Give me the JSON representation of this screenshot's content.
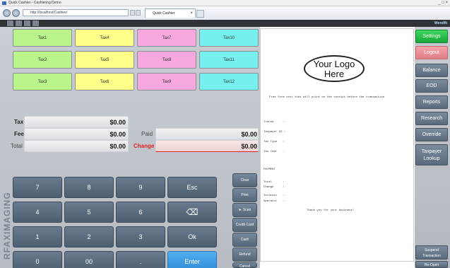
{
  "window": {
    "title": "Quick Cashier - Cashiering Demo",
    "controls": "_ □ ×"
  },
  "browser": {
    "url": "http://localhost/Cashier/",
    "tab_title": "Quick Cashier",
    "tab_close": "×"
  },
  "header": {
    "user_link": "Wendfk"
  },
  "tax_buttons": [
    {
      "label": "Tax1",
      "color": "#b9f58a"
    },
    {
      "label": "Tax4",
      "color": "#fefe88"
    },
    {
      "label": "Tax7",
      "color": "#f7a8de"
    },
    {
      "label": "Tax10",
      "color": "#75f0ef"
    },
    {
      "label": "Tax2",
      "color": "#b9f58a"
    },
    {
      "label": "Tax5",
      "color": "#fefe88"
    },
    {
      "label": "Tax8",
      "color": "#f7a8de"
    },
    {
      "label": "Tax11",
      "color": "#75f0ef"
    },
    {
      "label": "Tax3",
      "color": "#b9f58a"
    },
    {
      "label": "Tax6",
      "color": "#fefe88"
    },
    {
      "label": "Tax9",
      "color": "#f7a8de"
    },
    {
      "label": "Tax12",
      "color": "#75f0ef"
    }
  ],
  "totals": {
    "tax_label": "Tax",
    "tax_value": "$0.00",
    "fee_label": "Fee",
    "fee_value": "$0.00",
    "total_label": "Total",
    "total_value": "$0.00",
    "paid_label": "Paid",
    "paid_value": "$0.00",
    "change_label": "Change",
    "change_value": "$0.00",
    "change_color": "#e02020"
  },
  "keypad": {
    "k7": "7",
    "k8": "8",
    "k9": "9",
    "esc": "Esc",
    "k4": "4",
    "k5": "5",
    "k6": "6",
    "backspace": "⌫",
    "k1": "1",
    "k2": "2",
    "k3": "3",
    "ok": "Ok",
    "k0": "0",
    "k00": "00",
    "dot": ".",
    "enter": "Enter"
  },
  "side_buttons": {
    "clear": "Clear",
    "print": "Print",
    "scan": "► Scan",
    "credit_card": "Credit Card",
    "cash": "Cash",
    "refund": "Refund",
    "cancel": "Cancel"
  },
  "watermark": "RFAXIMAGING",
  "receipt": {
    "logo": "Your Logo Here",
    "header_text": "Free form text that will print on the receipt before the transaction",
    "trans_label": "Trans#",
    "trans_sep": ":",
    "taxpayer_id_label": "Taxpayer ID :",
    "tax_type_label": "Tax Type",
    "tax_type_sep": ":",
    "tax_year_label": "Tax Year",
    "tax_year_sep": ":",
    "payment_heading": "PAYMENT",
    "total_label": "Total",
    "total_sep": ":",
    "change_label": "Change",
    "change_sep": ":",
    "terminal_label": "Terminal",
    "terminal_sep": ":",
    "operator_label": "Operator",
    "operator_sep": ":",
    "footer_text": "Thank you for your business!"
  },
  "right_menu": {
    "settings": "Settings",
    "logout": "Logout",
    "balance": "Balance",
    "eod": "EOD",
    "reports": "Reports",
    "research": "Research",
    "override": "Override",
    "taxpayer_lookup": "Taxpayer Lookup",
    "suspend_transaction": "Suspend Transaction",
    "re_open": "Re-Open",
    "settings_color": "#1aa73a",
    "logout_color": "#e07f86"
  }
}
